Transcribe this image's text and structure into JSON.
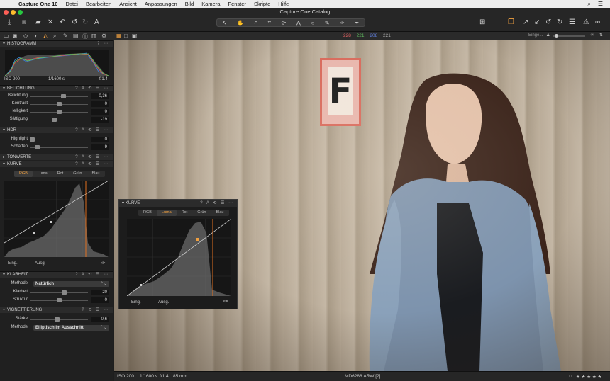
{
  "menubar": {
    "app_name": "Capture One 10",
    "items": [
      "Datei",
      "Bearbeiten",
      "Ansicht",
      "Anpassungen",
      "Bild",
      "Kamera",
      "Fenster",
      "Skripte",
      "Hilfe"
    ]
  },
  "window": {
    "title": "Capture One Catalog"
  },
  "tabrow": {
    "rgb": [
      "228",
      "221",
      "208",
      "221"
    ],
    "search_hint": "Einge..."
  },
  "left": {
    "histogram": {
      "title": "HISTOGRAMM",
      "iso": "ISO 200",
      "shutter": "1/1600 s",
      "aperture": "f/1.4"
    },
    "exposure": {
      "title": "BELICHTUNG",
      "rows": [
        {
          "label": "Belichtung",
          "value": "0,36",
          "knob": 0.58
        },
        {
          "label": "Kontrast",
          "value": "0",
          "knob": 0.5
        },
        {
          "label": "Helligkeit",
          "value": "0",
          "knob": 0.5
        },
        {
          "label": "Sättigung",
          "value": "-19",
          "knob": 0.41
        }
      ]
    },
    "hdr": {
      "title": "HDR",
      "rows": [
        {
          "label": "Highlight",
          "value": "0",
          "knob": 0.0
        },
        {
          "label": "Schatten",
          "value": "9",
          "knob": 0.09
        }
      ]
    },
    "tonwerte": {
      "title": "TONWERTE"
    },
    "kurve": {
      "title": "KURVE",
      "tabs": [
        "RGB",
        "Luma",
        "Rot",
        "Grün",
        "Blau"
      ],
      "in_label": "Eing.",
      "out_label": "Ausg."
    },
    "klarheit": {
      "title": "KLARHEIT",
      "method_label": "Methode",
      "method_value": "Natürlich",
      "rows": [
        {
          "label": "Klarheit",
          "value": "20",
          "knob": 0.6
        },
        {
          "label": "Struktur",
          "value": "0",
          "knob": 0.5
        }
      ]
    },
    "vignette": {
      "title": "VIGNETTIERUNG",
      "rows": [
        {
          "label": "Stärke",
          "value": "-0,6",
          "knob": 0.46
        }
      ],
      "method_label": "Methode",
      "method_value": "Elliptisch im Ausschnitt"
    }
  },
  "floatcurve": {
    "title": "KURVE",
    "tabs": [
      "RGB",
      "Luma",
      "Rot",
      "Grün",
      "Blau"
    ],
    "in_label": "Eing.",
    "out_label": "Ausg."
  },
  "status": {
    "iso": "ISO 200",
    "shutter": "1/1600 s",
    "aperture": "f/1.4",
    "focal": "85 mm",
    "filename": "MD6288.ARW [2]",
    "stars": "★ ★ ★ ★ ★"
  },
  "colors": {
    "accent": "#f0a040",
    "panel": "#202020",
    "traffic_red": "#fd5f57",
    "traffic_yellow": "#fdbc2e",
    "traffic_green": "#28c840"
  }
}
